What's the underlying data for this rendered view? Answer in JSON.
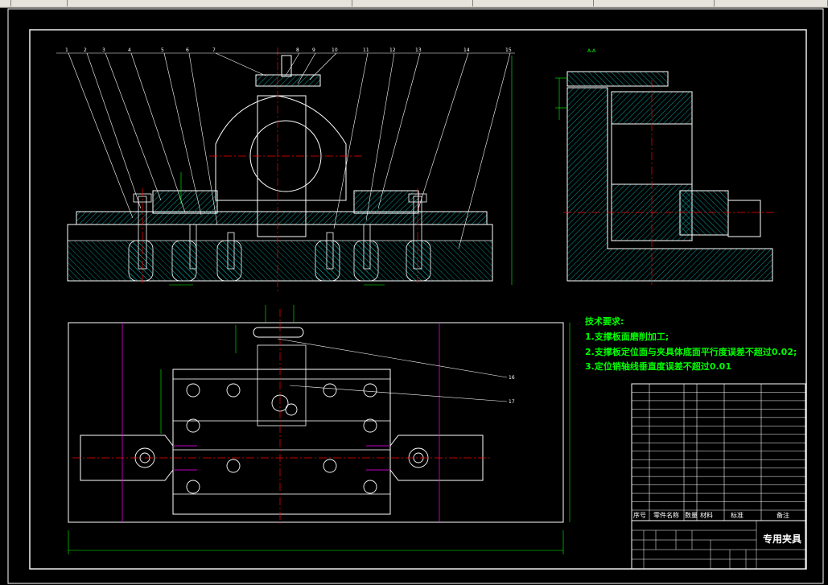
{
  "app": {
    "toolbar_segments": [
      "",
      "",
      "",
      "",
      "",
      "",
      ""
    ]
  },
  "colors": {
    "outline": "#ffffff",
    "centerline": "#ff0000",
    "dimension": "#00ff00",
    "hatch": "#00c8c8",
    "reference": "#ff00ff",
    "background": "#000000"
  },
  "tech_requirements": {
    "heading": "技术要求:",
    "items": [
      "1.支撑板面磨削加工;",
      "2.支撑板定位面与夹具体底面平行度误差不超过0.02;",
      "3.定位销轴线垂直度误差不超过0.01"
    ]
  },
  "balloons_top": [
    "1",
    "2",
    "3",
    "4",
    "5",
    "6",
    "7",
    "8",
    "9",
    "10",
    "11",
    "12",
    "13",
    "14",
    "15"
  ],
  "balloons_side": [
    "16",
    "17"
  ],
  "section_label": "A-A",
  "bom": {
    "header": [
      "序号",
      "零件名称",
      "数量",
      "材料",
      "标准",
      "备注"
    ]
  },
  "title_block": {
    "name": "专用夹具"
  }
}
